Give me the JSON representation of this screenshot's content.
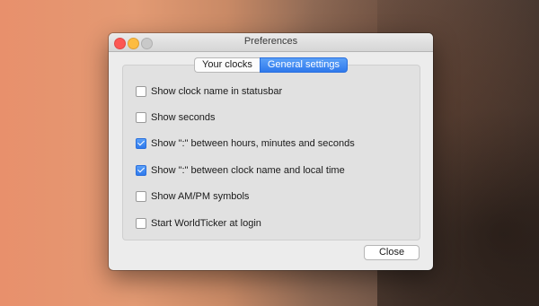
{
  "window": {
    "title": "Preferences"
  },
  "tabs": [
    {
      "label": "Your clocks",
      "active": false
    },
    {
      "label": "General settings",
      "active": true
    }
  ],
  "options": [
    {
      "label": "Show clock name in statusbar",
      "checked": false
    },
    {
      "label": "Show seconds",
      "checked": false
    },
    {
      "label": "Show \":\" between hours, minutes and seconds",
      "checked": true
    },
    {
      "label": "Show \":\" between clock name and local time",
      "checked": true
    },
    {
      "label": "Show AM/PM symbols",
      "checked": false
    },
    {
      "label": "Start WorldTicker at login",
      "checked": false
    }
  ],
  "footer": {
    "close_label": "Close"
  },
  "colors": {
    "accent": "#2f79ec",
    "window_bg": "#ececec",
    "traffic_close": "#fc5753",
    "traffic_minimize": "#fdbc40"
  }
}
